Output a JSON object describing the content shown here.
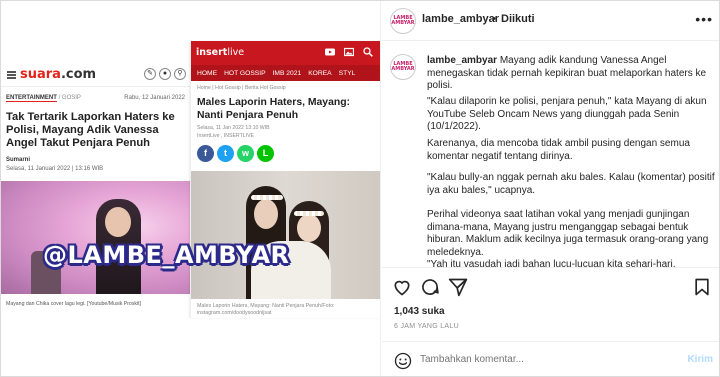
{
  "media": {
    "suara": {
      "logo_main": "suara",
      "logo_suffix": ".com",
      "category": "ENTERTAINMENT",
      "subcategory": "/ GOSIP",
      "date": "Rabu, 12 Januari 2022",
      "title": "Tak Tertarik Laporkan Haters ke Polisi, Mayang Adik Vanessa Angel Takut Penjara Penuh",
      "author": "Sumarni",
      "time": "Selasa, 11 Januari 2022 | 13:16 WIB",
      "caption": "Mayang dan Chika cover lagu legi. [Youtube/Musik Proskit]"
    },
    "insertlive": {
      "logo_main": "insert",
      "logo_suffix": "live",
      "nav": [
        "HOME",
        "HOT GOSSIP",
        "IMB 2021",
        "KOREA",
        "STYL"
      ],
      "breadcrumb": "Home | Hot Gossip | Berita Hot Gossip",
      "title": "Males Laporin Haters, Mayang: Nanti Penjara Penuh",
      "meta_date": "Selasa, 11 Jan 2022 13:10 WIB",
      "meta_source": "InsertLive , INSERTLIVE",
      "caption": "Males Laporin Haters, Mayang: Nanti Penjara Penuh/Foto: instagram.com/doodysoodnijsat"
    },
    "watermark": "@LAMBE_AMBYAR",
    "colors": {
      "suara_red": "#e2231a",
      "insert_red": "#c8171e",
      "watermark_outline": "#2b2a8a"
    }
  },
  "post": {
    "username": "lambe_ambyar",
    "separator": "•",
    "follow_state": "Diikuti",
    "avatar_text": "LAMBE AMBYAR",
    "caption_user": "lambe_ambyar",
    "caption_paragraphs": [
      "Mayang adik kandung Vanessa Angel menegaskan tidak pernah kepikiran buat melaporkan haters ke polisi.",
      "\"Kalau dilaporin ke polisi, penjara penuh,\" kata Mayang di akun YouTube Seleb Oncam News yang diunggah pada Senin (10/1/2022).",
      "Karenanya, dia mencoba tidak ambil pusing dengan semua komentar negatif tentang dirinya.",
      "\"Kalau bully-an nggak pernah aku bales. Kalau (komentar) positif iya aku bales,\" ucapnya.",
      "Perihal videonya saat latihan vokal yang menjadi gunjingan dimana-mana, Mayang justru menganggap sebagai bentuk hiburan. Maklum adik kecilnya juga termasuk orang-orang yang meledeknya.",
      "\"Yah itu vasudah jadi bahan lucu-lucuan kita sehari-hari. Terkadang"
    ],
    "likes": "1,043 suka",
    "time_ago": "6 JAM YANG LALU",
    "comment_placeholder": "Tambahkan komentar...",
    "post_button": "Kirim",
    "icons": [
      "heart-icon",
      "comment-icon",
      "share-icon",
      "bookmark-icon",
      "emoji-icon",
      "more-icon"
    ],
    "colors": {
      "text": "#262626",
      "muted": "#8e8e8e",
      "post_disabled": "#b3dbff"
    }
  }
}
